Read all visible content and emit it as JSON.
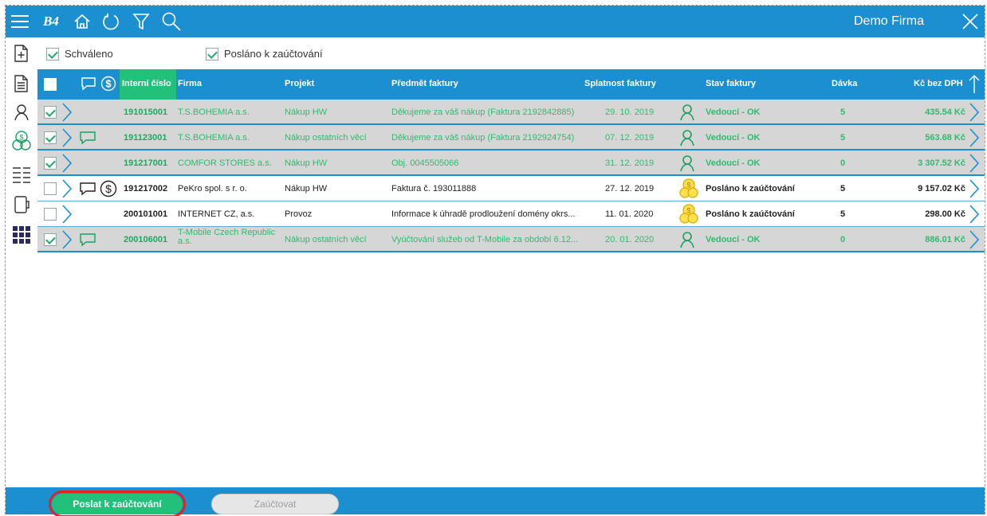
{
  "topbar": {
    "logo_text": "B4",
    "company": "Demo Firma",
    "icons": [
      "menu-icon",
      "home-icon",
      "refresh-icon",
      "filter-icon",
      "search-icon",
      "close-icon"
    ]
  },
  "sidebar": {
    "icons": [
      "new-document-icon",
      "document-icon",
      "person-icon",
      "coins-icon",
      "list-icon",
      "book-icon",
      "apps-grid-icon"
    ]
  },
  "filters": {
    "schvaleno": {
      "label": "Schváleno",
      "checked": true
    },
    "poslano": {
      "label": "Posláno k zaúčtování",
      "checked": true
    }
  },
  "table": {
    "headers": {
      "interni": "Interní číslo",
      "firma": "Firma",
      "projekt": "Projekt",
      "predmet": "Předmět faktury",
      "splatnost": "Splatnost faktury",
      "stav": "Stav faktury",
      "davka": "Dávka",
      "castka": "Kč bez DPH"
    },
    "rows": [
      {
        "checked": true,
        "comment": false,
        "dollar": false,
        "status_icon": "person-icon",
        "interni": "191015001",
        "firma": "T.S.BOHEMIA a.s.",
        "projekt": "Nákup HW",
        "predmet": "Děkujeme za váš nákup (Faktura 2192842885)",
        "splatnost": "29. 10. 2019",
        "stav": "Vedoucí - OK",
        "davka": "5",
        "castka": "435.54 Kč"
      },
      {
        "checked": true,
        "comment": true,
        "dollar": false,
        "status_icon": "person-icon",
        "interni": "191123001",
        "firma": "T.S.BOHEMIA a.s.",
        "projekt": "Nákup ostatních věcí",
        "predmet": "Děkujeme za váš nákup (Faktura 2192924754)",
        "splatnost": "07. 12. 2019",
        "stav": "Vedoucí - OK",
        "davka": "5",
        "castka": "563.68 Kč"
      },
      {
        "checked": true,
        "comment": false,
        "dollar": false,
        "status_icon": "person-icon",
        "interni": "191217001",
        "firma": "COMFOR STORES a.s.",
        "projekt": "Nákup HW",
        "predmet": "Obj. 0045505066",
        "splatnost": "31. 12. 2019",
        "stav": "Vedoucí - OK",
        "davka": "0",
        "castka": "3 307.52 Kč"
      },
      {
        "checked": false,
        "comment": true,
        "dollar": true,
        "status_icon": "coins-icon",
        "interni": "191217002",
        "firma": "PeKro spol. s r. o.",
        "projekt": "Nákup HW",
        "predmet": "Faktura č. 193011888",
        "splatnost": "27. 12. 2019",
        "stav": "Posláno k zaúčtování",
        "davka": "5",
        "castka": "9 157.02 Kč"
      },
      {
        "checked": false,
        "comment": false,
        "dollar": false,
        "status_icon": "coins-icon",
        "interni": "200101001",
        "firma": "INTERNET CZ, a.s.",
        "projekt": "Provoz",
        "predmet": "Informace k úhradě prodloužení domény okrs...",
        "splatnost": "11. 01. 2020",
        "stav": "Posláno k zaúčtování",
        "davka": "5",
        "castka": "298.00 Kč"
      },
      {
        "checked": true,
        "comment": true,
        "dollar": false,
        "status_icon": "person-icon",
        "interni": "200106001",
        "firma": "T-Mobile Czech Republic a.s.",
        "projekt": "Nákup ostatních věcí",
        "predmet": "Vyúčtování služeb od T-Mobile za období 6.12...",
        "splatnost": "20. 01. 2020",
        "stav": "Vedoucí - OK",
        "davka": "0",
        "castka": "886.01 Kč"
      }
    ]
  },
  "buttons": {
    "send": "Poslat k zaúčtování",
    "post": "Zaúčtovat"
  },
  "colors": {
    "primary": "#1b8fd0",
    "green": "#22c07a",
    "highlight": "#e02424",
    "coin": "#e6b800"
  }
}
